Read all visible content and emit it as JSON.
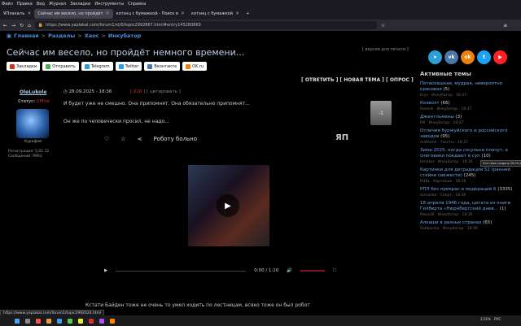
{
  "menu": [
    "Файл",
    "Правка",
    "Вид",
    "Журнал",
    "Закладки",
    "Инструменты",
    "Справка"
  ],
  "tabs": [
    {
      "label": "ЯПлакалъ",
      "active": false
    },
    {
      "label": "Сейчас им весело, но пройдёт",
      "active": true
    },
    {
      "label": "котэнц с бумажкой - Поиск в",
      "active": false
    },
    {
      "label": "котэнц с бумажкой",
      "active": false
    }
  ],
  "address": {
    "url": "https://www.yaplakal.com/forum1/st/0/topic2992867.html#entry145280869"
  },
  "breadcrumbs": [
    "Главная",
    "Разделы",
    "Хаос",
    "Инкубатор"
  ],
  "breadcrumb_sep": ">",
  "topic_title": "Сейчас им весело, но пройдёт немного времени...",
  "print_version": "[ версия для печати ]",
  "share_buttons": [
    {
      "label": "Закладки",
      "color": "#c32"
    },
    {
      "label": "Отправить",
      "color": "#5a5"
    },
    {
      "label": "Telegram",
      "color": "#2a9fd8"
    },
    {
      "label": "Twitter",
      "color": "#1da1f2"
    },
    {
      "label": "Вконтакте",
      "color": "#4a76a8"
    },
    {
      "label": "OK.ru",
      "color": "#ee8208"
    }
  ],
  "topic_actions": "[ ОТВЕТИТЬ ] [ НОВАЯ ТЕМА ] [ ОПРОС ]",
  "post": {
    "author": "OleLukole",
    "status_label": "Статус:",
    "status_value": "Offline",
    "avatar_caption": "Курофей",
    "reg_line": "Регистрация: 5.01.12",
    "msgs_line": "Сообщений: 9963",
    "date": "28.09.2025 - 18:36",
    "rating_tag": "[ 216 ]",
    "quote_tag": "[ цитировать ]",
    "text1": "И будет уже не смешно. Она припомнят. Она обязательно припомнят...",
    "text2": "Он же по человечески просил, не надо...",
    "rating_value": "-1",
    "embed_title": "Роботу больно",
    "logo": "ЯП",
    "video_time": "0:00 / 1:10",
    "footer_text": "Кстати Байден тоже не очень то умел ходить по лестницам, всяко тоже он был робот"
  },
  "social_icons": [
    {
      "name": "telegram-icon",
      "glyph": "➤",
      "color": "#2a9fd8"
    },
    {
      "name": "vk-icon",
      "glyph": "vk",
      "color": "#4a76a8"
    },
    {
      "name": "ok-icon",
      "glyph": "ok",
      "color": "#ee8208"
    },
    {
      "name": "twitter-icon",
      "glyph": "t",
      "color": "#1da1f2"
    },
    {
      "name": "youtube-icon",
      "glyph": "▶",
      "color": "#f22"
    }
  ],
  "active_topics_header": "Активные темы",
  "active_topics": [
    {
      "title": "Потаскашкая, мудрая, невероятно красивая",
      "count": "(5)",
      "meta": "Eryx · Инкубатор · 18:37"
    },
    {
      "title": "Коэволт",
      "count": "(66)",
      "meta": "Rasenk · Инкубатор · 18:37"
    },
    {
      "title": "Джентльмены",
      "count": "(3)",
      "meta": "Pill · Инкубатор · 18:37"
    },
    {
      "title": "Отличия буржуйского и российского заводов",
      "count": "(95)",
      "meta": "maftumn · Техсты · 18:37"
    },
    {
      "title": "Зима-2025: когда сосульки плачут, а снеговики поедают в суп",
      "count": "(10)",
      "meta": "Hmaker · Инкубатор · 18:36"
    },
    {
      "title": "Картинки для деградации 52 (ранний стейне свежести)",
      "count": "(245)",
      "meta": "RUBL · Картинки · 18:36"
    },
    {
      "title": "РПЛ без прикрас и модераций 6",
      "count": "(3335)",
      "meta": "stavanka · Спорт · 18:36"
    },
    {
      "title": "18 апреля 1946 года, цитата из книги Гилберта «Нюрнбергский днев...",
      "count": "(1)",
      "meta": "Masa38 · Инкубатор · 18:36"
    },
    {
      "title": "Алкаши в разных странах",
      "count": "(65)",
      "meta": "Sabbuinka · Инкубатор · 18:36"
    }
  ],
  "tooltip": "Эта тема создана 28.09.2025",
  "status_url": "https://www.yaplakal.com/forum1/topic2992024.html",
  "tray": {
    "zoom": "133%",
    "lang": "РУС"
  }
}
